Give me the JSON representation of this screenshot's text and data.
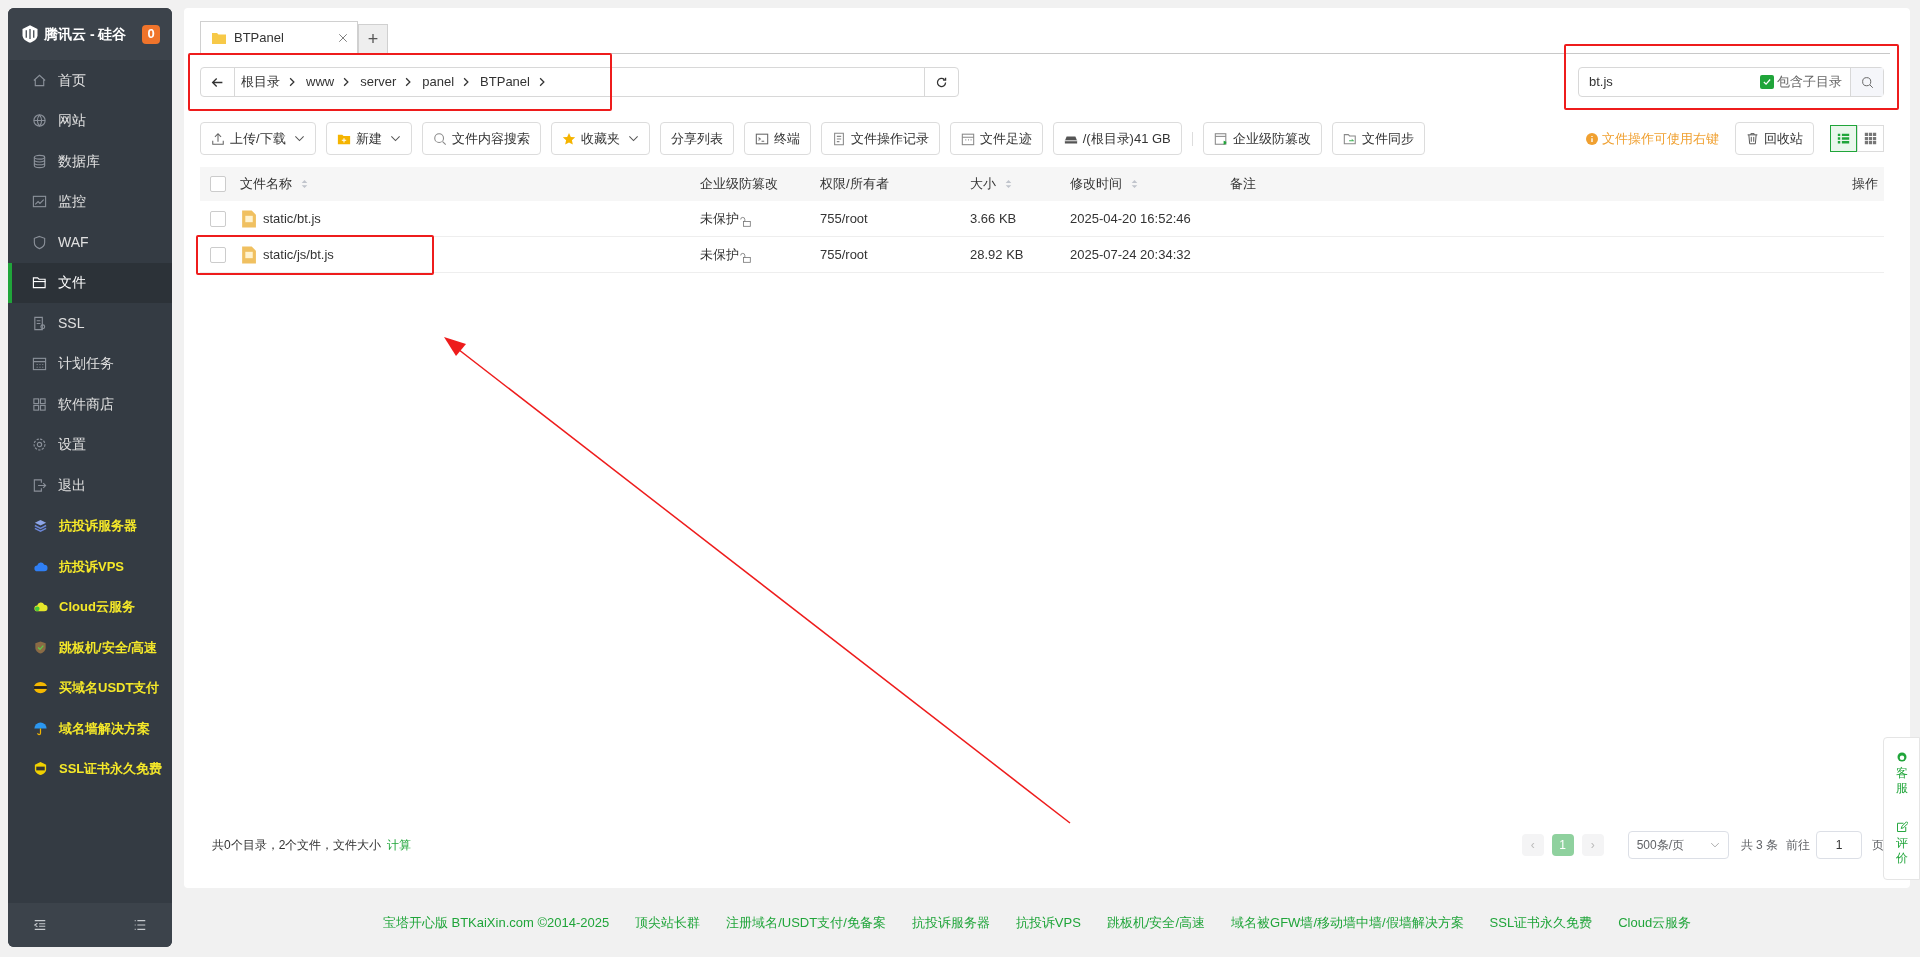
{
  "brand": {
    "name": "腾讯云 - 硅谷",
    "badge": "0"
  },
  "sidebar": {
    "items": [
      {
        "label": "首页",
        "kind": "menu",
        "selected": false
      },
      {
        "label": "网站",
        "kind": "menu",
        "selected": false
      },
      {
        "label": "数据库",
        "kind": "menu",
        "selected": false
      },
      {
        "label": "监控",
        "kind": "menu",
        "selected": false
      },
      {
        "label": "WAF",
        "kind": "menu",
        "selected": false
      },
      {
        "label": "文件",
        "kind": "menu",
        "selected": true
      },
      {
        "label": "SSL",
        "kind": "menu",
        "selected": false
      },
      {
        "label": "计划任务",
        "kind": "menu",
        "selected": false
      },
      {
        "label": "软件商店",
        "kind": "menu",
        "selected": false
      },
      {
        "label": "设置",
        "kind": "menu",
        "selected": false
      },
      {
        "label": "退出",
        "kind": "menu",
        "selected": false
      },
      {
        "label": "抗投诉服务器",
        "kind": "promo",
        "selected": false
      },
      {
        "label": "抗投诉VPS",
        "kind": "promo",
        "selected": false
      },
      {
        "label": "Cloud云服务",
        "kind": "promo",
        "selected": false
      },
      {
        "label": "跳板机/安全/高速",
        "kind": "promo",
        "selected": false
      },
      {
        "label": "买域名USDT支付",
        "kind": "promo",
        "selected": false
      },
      {
        "label": "域名墙解决方案",
        "kind": "promo",
        "selected": false
      },
      {
        "label": "SSL证书永久免费",
        "kind": "promo",
        "selected": false
      }
    ]
  },
  "tabs": [
    {
      "label": "BTPanel",
      "selected": true
    }
  ],
  "add_tab": "+",
  "breadcrumb": {
    "highlighted": true,
    "segments": [
      "根目录",
      "www",
      "server",
      "panel",
      "BTPanel"
    ]
  },
  "search": {
    "value": "bt.js",
    "highlighted": true,
    "include_subdirs": {
      "label": "包含子目录",
      "checked": true
    }
  },
  "toolbar": [
    {
      "label": "上传/下载",
      "kind": "upload",
      "dropdown": true
    },
    {
      "label": "新建",
      "kind": "new",
      "dropdown": true
    },
    {
      "label": "文件内容搜索",
      "kind": "search",
      "dropdown": false
    },
    {
      "label": "收藏夹",
      "kind": "star",
      "dropdown": true
    },
    {
      "label": "分享列表",
      "kind": "plain",
      "dropdown": false
    },
    {
      "label": "终端",
      "kind": "terminal",
      "dropdown": false
    },
    {
      "label": "文件操作记录",
      "kind": "doc",
      "dropdown": false
    },
    {
      "label": "文件足迹",
      "kind": "calendar",
      "dropdown": false
    },
    {
      "label": "/(根目录)41 GB",
      "kind": "disk",
      "dropdown": false
    },
    {
      "label": "企业级防篡改",
      "kind": "shield",
      "dropdown": false
    },
    {
      "label": "文件同步",
      "kind": "sync",
      "dropdown": false
    }
  ],
  "hint": "文件操作可使用右键",
  "recycle": "回收站",
  "view_modes": [
    {
      "kind": "list",
      "selected": true
    },
    {
      "kind": "grid",
      "selected": false
    }
  ],
  "table": {
    "all_checked": false,
    "columns": [
      {
        "label": "文件名称",
        "sortable": true
      },
      {
        "label": "企业级防篡改",
        "sortable": false
      },
      {
        "label": "权限/所有者",
        "sortable": false
      },
      {
        "label": "大小",
        "sortable": true
      },
      {
        "label": "修改时间",
        "sortable": true
      },
      {
        "label": "备注",
        "sortable": false
      },
      {
        "label": "操作",
        "sortable": false
      }
    ],
    "rows": [
      {
        "name": "static/bt.js",
        "protect": "未保护",
        "perm": "755/root",
        "size": "3.66 KB",
        "mtime": "2025-04-20 16:52:46",
        "checked": false,
        "highlighted": false
      },
      {
        "name": "static/js/bt.js",
        "protect": "未保护",
        "perm": "755/root",
        "size": "28.92 KB",
        "mtime": "2025-07-24 20:34:32",
        "checked": false,
        "highlighted": true
      }
    ]
  },
  "summary": {
    "text": "共0个目录，2个文件，文件大小",
    "link": "计算"
  },
  "pagination": {
    "prev": "‹",
    "pages": [
      {
        "label": "1",
        "selected": true
      }
    ],
    "next": "›",
    "per_page": "500条/页",
    "total": "共 3 条",
    "goto_label": "前往",
    "goto_value": "1",
    "page_unit": "页"
  },
  "float_widget": [
    "客服",
    "评价"
  ],
  "footer_links": [
    "宝塔开心版 BTKaiXin.com ©2014-2025",
    "顶尖站长群",
    "注册域名/USDT支付/免备案",
    "抗投诉服务器",
    "抗投诉VPS",
    "跳板机/安全/高速",
    "域名被GFW墙/移动墙中墙/假墙解决方案",
    "SSL证书永久免费",
    "Cloud云服务"
  ]
}
